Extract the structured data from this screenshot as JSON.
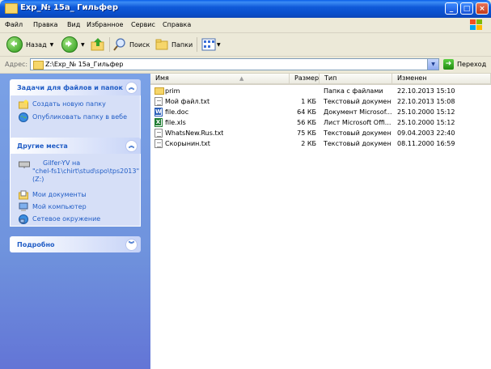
{
  "window": {
    "title": "Exp_№ 15a_ Гильфер",
    "minimize": "_",
    "maximize": "□",
    "close": "×"
  },
  "menu": [
    "Файл",
    "Правка",
    "Вид",
    "Избранное",
    "Сервис",
    "Справка"
  ],
  "toolbar": {
    "back": "Назад",
    "search": "Поиск",
    "folders": "Папки"
  },
  "address": {
    "label": "Адрес:",
    "value": "Z:\\Exp_№ 15a_Гильфер",
    "go": "Переход"
  },
  "taskpane": {
    "tasks": {
      "title": "Задачи для файлов и папок",
      "items": [
        {
          "label": "Создать новую папку",
          "icon": "new-folder-icon"
        },
        {
          "label": "Опубликовать папку в вебе",
          "icon": "publish-web-icon"
        }
      ]
    },
    "places": {
      "title": "Другие места",
      "drive_line1": "Gilfer-YV на",
      "drive_line2": "\"chel-fs1\\chirt\\stud\\spo\\tps2013\"",
      "drive_line3": "(Z:)",
      "items": [
        {
          "label": "Мои документы",
          "icon": "my-documents-icon"
        },
        {
          "label": "Мой компьютер",
          "icon": "my-computer-icon"
        },
        {
          "label": "Сетевое окружение",
          "icon": "network-icon"
        }
      ]
    },
    "details": {
      "title": "Подробно"
    }
  },
  "filelist": {
    "columns": {
      "name": "Имя",
      "size": "Размер",
      "type": "Тип",
      "modified": "Изменен"
    },
    "rows": [
      {
        "name": "prim",
        "size": "",
        "type": "Папка с файлами",
        "modified": "22.10.2013 15:10",
        "icon": "folder"
      },
      {
        "name": "Мой файл.txt",
        "size": "1 КБ",
        "type": "Текстовый документ",
        "modified": "22.10.2013 15:08",
        "icon": "txt"
      },
      {
        "name": "file.doc",
        "size": "64 КБ",
        "type": "Документ Microsof...",
        "modified": "25.10.2000 15:12",
        "icon": "doc"
      },
      {
        "name": "file.xls",
        "size": "56 КБ",
        "type": "Лист Microsoft Offi...",
        "modified": "25.10.2000 15:12",
        "icon": "xls"
      },
      {
        "name": "WhatsNew.Rus.txt",
        "size": "75 КБ",
        "type": "Текстовый документ",
        "modified": "09.04.2003 22:40",
        "icon": "txt"
      },
      {
        "name": "Скорынин.txt",
        "size": "2 КБ",
        "type": "Текстовый документ",
        "modified": "08.11.2000 16:59",
        "icon": "txt"
      }
    ]
  }
}
